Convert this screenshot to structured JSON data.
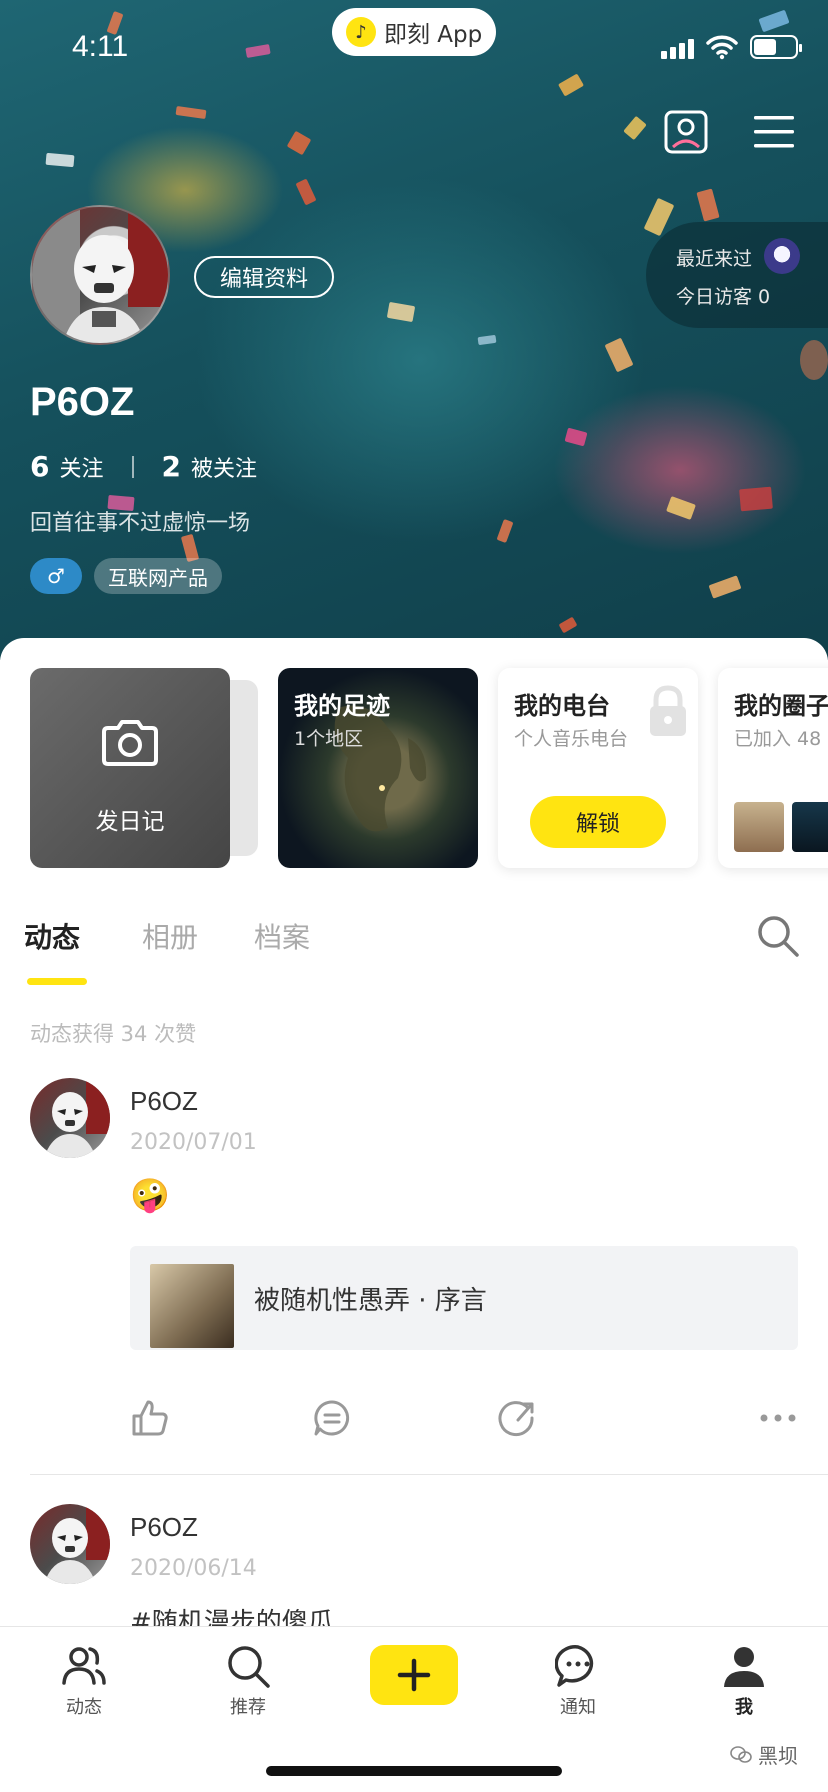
{
  "status_bar": {
    "time": "4:11",
    "app_pill": "即刻 App"
  },
  "profile": {
    "edit_label": "编辑资料",
    "username": "P6OZ",
    "following_count": "6",
    "following_label": "关注",
    "followers_count": "2",
    "followers_label": "被关注",
    "bio": "回首往事不过虚惊一场",
    "gender_tag": "♂",
    "job_tag": "互联网产品",
    "recent_visit_label": "最近来过",
    "today_visitors_label": "今日访客 0"
  },
  "cards": {
    "diary_label": "发日记",
    "trail_title": "我的足迹",
    "trail_sub": "1个地区",
    "radio_title": "我的电台",
    "radio_sub": "个人音乐电台",
    "radio_button": "解锁",
    "circle_title": "我的圈子",
    "circle_sub": "已加入 48"
  },
  "tabs": [
    "动态",
    "相册",
    "档案"
  ],
  "likes_summary": "动态获得 34 次赞",
  "posts": [
    {
      "name": "P6OZ",
      "date": "2020/07/01",
      "emoji": "🤪",
      "share_title": "被随机性愚弄 · 序言"
    },
    {
      "name": "P6OZ",
      "date": "2020/06/14",
      "text": "#随机漫步的傻瓜"
    }
  ],
  "tabbar": {
    "feed": "动态",
    "recommend": "推荐",
    "notify": "通知",
    "me": "我"
  },
  "watermark": "黑坝",
  "colors": {
    "accent": "#ffe411",
    "gender_tag": "#2d8ac7"
  },
  "icons": [
    "profile-card-icon",
    "menu-icon",
    "camera-icon",
    "lock-icon",
    "search-icon",
    "thumb-up-icon",
    "comment-icon",
    "share-icon",
    "more-icon",
    "people-icon",
    "plus-icon",
    "chat-bubble-icon",
    "person-icon"
  ]
}
